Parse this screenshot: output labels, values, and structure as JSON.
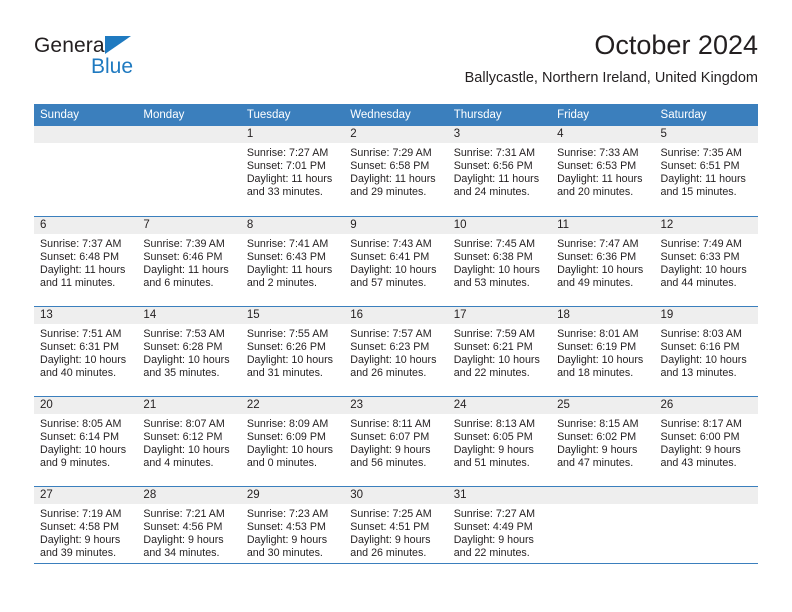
{
  "brand": {
    "name_top": "General",
    "name_bottom": "Blue",
    "triangle_color": "#1f7ac0"
  },
  "header": {
    "title": "October 2024",
    "subtitle": "Ballycastle, Northern Ireland, United Kingdom"
  },
  "theme": {
    "header_blue": "#3b7fbd",
    "day_band_gray": "#eeeeee",
    "text": "#231f20",
    "brand_blue": "#1f7ac0"
  },
  "weekdays": [
    "Sunday",
    "Monday",
    "Tuesday",
    "Wednesday",
    "Thursday",
    "Friday",
    "Saturday"
  ],
  "weeks": [
    [
      {
        "day": "",
        "lines": []
      },
      {
        "day": "",
        "lines": []
      },
      {
        "day": "1",
        "lines": [
          "Sunrise: 7:27 AM",
          "Sunset: 7:01 PM",
          "Daylight: 11 hours",
          "and 33 minutes."
        ]
      },
      {
        "day": "2",
        "lines": [
          "Sunrise: 7:29 AM",
          "Sunset: 6:58 PM",
          "Daylight: 11 hours",
          "and 29 minutes."
        ]
      },
      {
        "day": "3",
        "lines": [
          "Sunrise: 7:31 AM",
          "Sunset: 6:56 PM",
          "Daylight: 11 hours",
          "and 24 minutes."
        ]
      },
      {
        "day": "4",
        "lines": [
          "Sunrise: 7:33 AM",
          "Sunset: 6:53 PM",
          "Daylight: 11 hours",
          "and 20 minutes."
        ]
      },
      {
        "day": "5",
        "lines": [
          "Sunrise: 7:35 AM",
          "Sunset: 6:51 PM",
          "Daylight: 11 hours",
          "and 15 minutes."
        ]
      }
    ],
    [
      {
        "day": "6",
        "lines": [
          "Sunrise: 7:37 AM",
          "Sunset: 6:48 PM",
          "Daylight: 11 hours",
          "and 11 minutes."
        ]
      },
      {
        "day": "7",
        "lines": [
          "Sunrise: 7:39 AM",
          "Sunset: 6:46 PM",
          "Daylight: 11 hours",
          "and 6 minutes."
        ]
      },
      {
        "day": "8",
        "lines": [
          "Sunrise: 7:41 AM",
          "Sunset: 6:43 PM",
          "Daylight: 11 hours",
          "and 2 minutes."
        ]
      },
      {
        "day": "9",
        "lines": [
          "Sunrise: 7:43 AM",
          "Sunset: 6:41 PM",
          "Daylight: 10 hours",
          "and 57 minutes."
        ]
      },
      {
        "day": "10",
        "lines": [
          "Sunrise: 7:45 AM",
          "Sunset: 6:38 PM",
          "Daylight: 10 hours",
          "and 53 minutes."
        ]
      },
      {
        "day": "11",
        "lines": [
          "Sunrise: 7:47 AM",
          "Sunset: 6:36 PM",
          "Daylight: 10 hours",
          "and 49 minutes."
        ]
      },
      {
        "day": "12",
        "lines": [
          "Sunrise: 7:49 AM",
          "Sunset: 6:33 PM",
          "Daylight: 10 hours",
          "and 44 minutes."
        ]
      }
    ],
    [
      {
        "day": "13",
        "lines": [
          "Sunrise: 7:51 AM",
          "Sunset: 6:31 PM",
          "Daylight: 10 hours",
          "and 40 minutes."
        ]
      },
      {
        "day": "14",
        "lines": [
          "Sunrise: 7:53 AM",
          "Sunset: 6:28 PM",
          "Daylight: 10 hours",
          "and 35 minutes."
        ]
      },
      {
        "day": "15",
        "lines": [
          "Sunrise: 7:55 AM",
          "Sunset: 6:26 PM",
          "Daylight: 10 hours",
          "and 31 minutes."
        ]
      },
      {
        "day": "16",
        "lines": [
          "Sunrise: 7:57 AM",
          "Sunset: 6:23 PM",
          "Daylight: 10 hours",
          "and 26 minutes."
        ]
      },
      {
        "day": "17",
        "lines": [
          "Sunrise: 7:59 AM",
          "Sunset: 6:21 PM",
          "Daylight: 10 hours",
          "and 22 minutes."
        ]
      },
      {
        "day": "18",
        "lines": [
          "Sunrise: 8:01 AM",
          "Sunset: 6:19 PM",
          "Daylight: 10 hours",
          "and 18 minutes."
        ]
      },
      {
        "day": "19",
        "lines": [
          "Sunrise: 8:03 AM",
          "Sunset: 6:16 PM",
          "Daylight: 10 hours",
          "and 13 minutes."
        ]
      }
    ],
    [
      {
        "day": "20",
        "lines": [
          "Sunrise: 8:05 AM",
          "Sunset: 6:14 PM",
          "Daylight: 10 hours",
          "and 9 minutes."
        ]
      },
      {
        "day": "21",
        "lines": [
          "Sunrise: 8:07 AM",
          "Sunset: 6:12 PM",
          "Daylight: 10 hours",
          "and 4 minutes."
        ]
      },
      {
        "day": "22",
        "lines": [
          "Sunrise: 8:09 AM",
          "Sunset: 6:09 PM",
          "Daylight: 10 hours",
          "and 0 minutes."
        ]
      },
      {
        "day": "23",
        "lines": [
          "Sunrise: 8:11 AM",
          "Sunset: 6:07 PM",
          "Daylight: 9 hours",
          "and 56 minutes."
        ]
      },
      {
        "day": "24",
        "lines": [
          "Sunrise: 8:13 AM",
          "Sunset: 6:05 PM",
          "Daylight: 9 hours",
          "and 51 minutes."
        ]
      },
      {
        "day": "25",
        "lines": [
          "Sunrise: 8:15 AM",
          "Sunset: 6:02 PM",
          "Daylight: 9 hours",
          "and 47 minutes."
        ]
      },
      {
        "day": "26",
        "lines": [
          "Sunrise: 8:17 AM",
          "Sunset: 6:00 PM",
          "Daylight: 9 hours",
          "and 43 minutes."
        ]
      }
    ],
    [
      {
        "day": "27",
        "lines": [
          "Sunrise: 7:19 AM",
          "Sunset: 4:58 PM",
          "Daylight: 9 hours",
          "and 39 minutes."
        ]
      },
      {
        "day": "28",
        "lines": [
          "Sunrise: 7:21 AM",
          "Sunset: 4:56 PM",
          "Daylight: 9 hours",
          "and 34 minutes."
        ]
      },
      {
        "day": "29",
        "lines": [
          "Sunrise: 7:23 AM",
          "Sunset: 4:53 PM",
          "Daylight: 9 hours",
          "and 30 minutes."
        ]
      },
      {
        "day": "30",
        "lines": [
          "Sunrise: 7:25 AM",
          "Sunset: 4:51 PM",
          "Daylight: 9 hours",
          "and 26 minutes."
        ]
      },
      {
        "day": "31",
        "lines": [
          "Sunrise: 7:27 AM",
          "Sunset: 4:49 PM",
          "Daylight: 9 hours",
          "and 22 minutes."
        ]
      },
      {
        "day": "",
        "lines": []
      },
      {
        "day": "",
        "lines": []
      }
    ]
  ]
}
